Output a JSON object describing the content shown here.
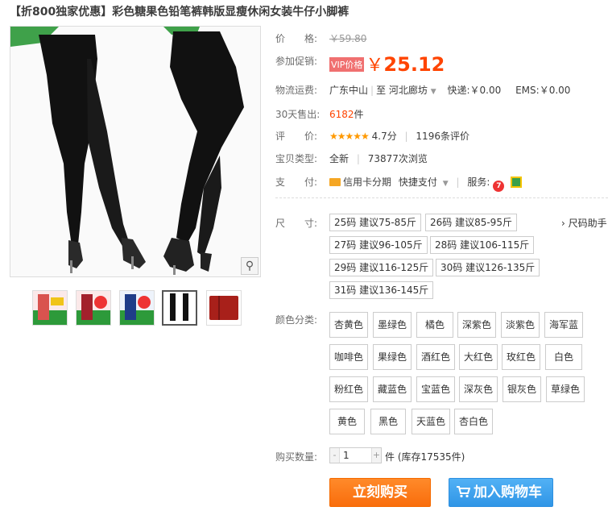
{
  "product": {
    "title": "【折800独家优惠】彩色糖果色铅笔裤韩版显瘦休闲女装牛仔小脚裤"
  },
  "gallery": {
    "zoom_icon": "magnifier-icon",
    "thumbnails": [
      "thumb-promo-pink",
      "thumb-promo-red",
      "thumb-promo-blue",
      "thumb-black-pants",
      "thumb-red-pants"
    ],
    "active_index": 3
  },
  "info": {
    "price": {
      "label": "价　　格:",
      "value": "￥59.80"
    },
    "promo": {
      "label": "参加促销:",
      "badge": "VIP价格",
      "currency": "￥",
      "value": "25.12"
    },
    "shipping": {
      "label": "物流运费:",
      "from": "广东中山",
      "to_prefix": "至",
      "to": "河北廊坊",
      "express": "快递:￥0.00",
      "ems": "EMS:￥0.00"
    },
    "sales": {
      "label": "30天售出:",
      "count": "6182",
      "unit": "件"
    },
    "rating": {
      "label": "评　　价:",
      "stars": "★★★★★",
      "score": "4.7分",
      "reviews": "1196条评价"
    },
    "type": {
      "label": "宝贝类型:",
      "condition": "全新",
      "views": "73877次浏览"
    },
    "payment": {
      "label": "支　　付:",
      "method1": "信用卡分期",
      "method2": "快捷支付",
      "service_label": "服务:"
    }
  },
  "sizes": {
    "label": "尺　　寸:",
    "help": "› 尺码助手",
    "options": [
      "25码 建议75-85斤",
      "26码 建议85-95斤",
      "27码 建议96-105斤",
      "28码 建议106-115斤",
      "29码 建议116-125斤",
      "30码 建议126-135斤",
      "31码 建议136-145斤"
    ]
  },
  "colors": {
    "label": "颜色分类:",
    "options": [
      "杏黄色",
      "墨绿色",
      "橘色",
      "深紫色",
      "淡紫色",
      "海军蓝",
      "咖啡色",
      "果绿色",
      "酒红色",
      "大红色",
      "玫红色",
      "白色",
      "粉红色",
      "藏蓝色",
      "宝蓝色",
      "深灰色",
      "银灰色",
      "草绿色",
      "黄色",
      "黑色",
      "天蓝色",
      "杏白色"
    ]
  },
  "quantity": {
    "label": "购买数量:",
    "value": "1",
    "minus": "-",
    "plus": "+",
    "stock_text": "件 (库存17535件)"
  },
  "actions": {
    "buy_now": "立刻购买",
    "add_to_cart": "加入购物车",
    "cart_icon": "cart-icon"
  },
  "colors_theme": {
    "accent": "#ff4400",
    "buy_button": "#f96d0c",
    "cart_button": "#3a9de8"
  }
}
